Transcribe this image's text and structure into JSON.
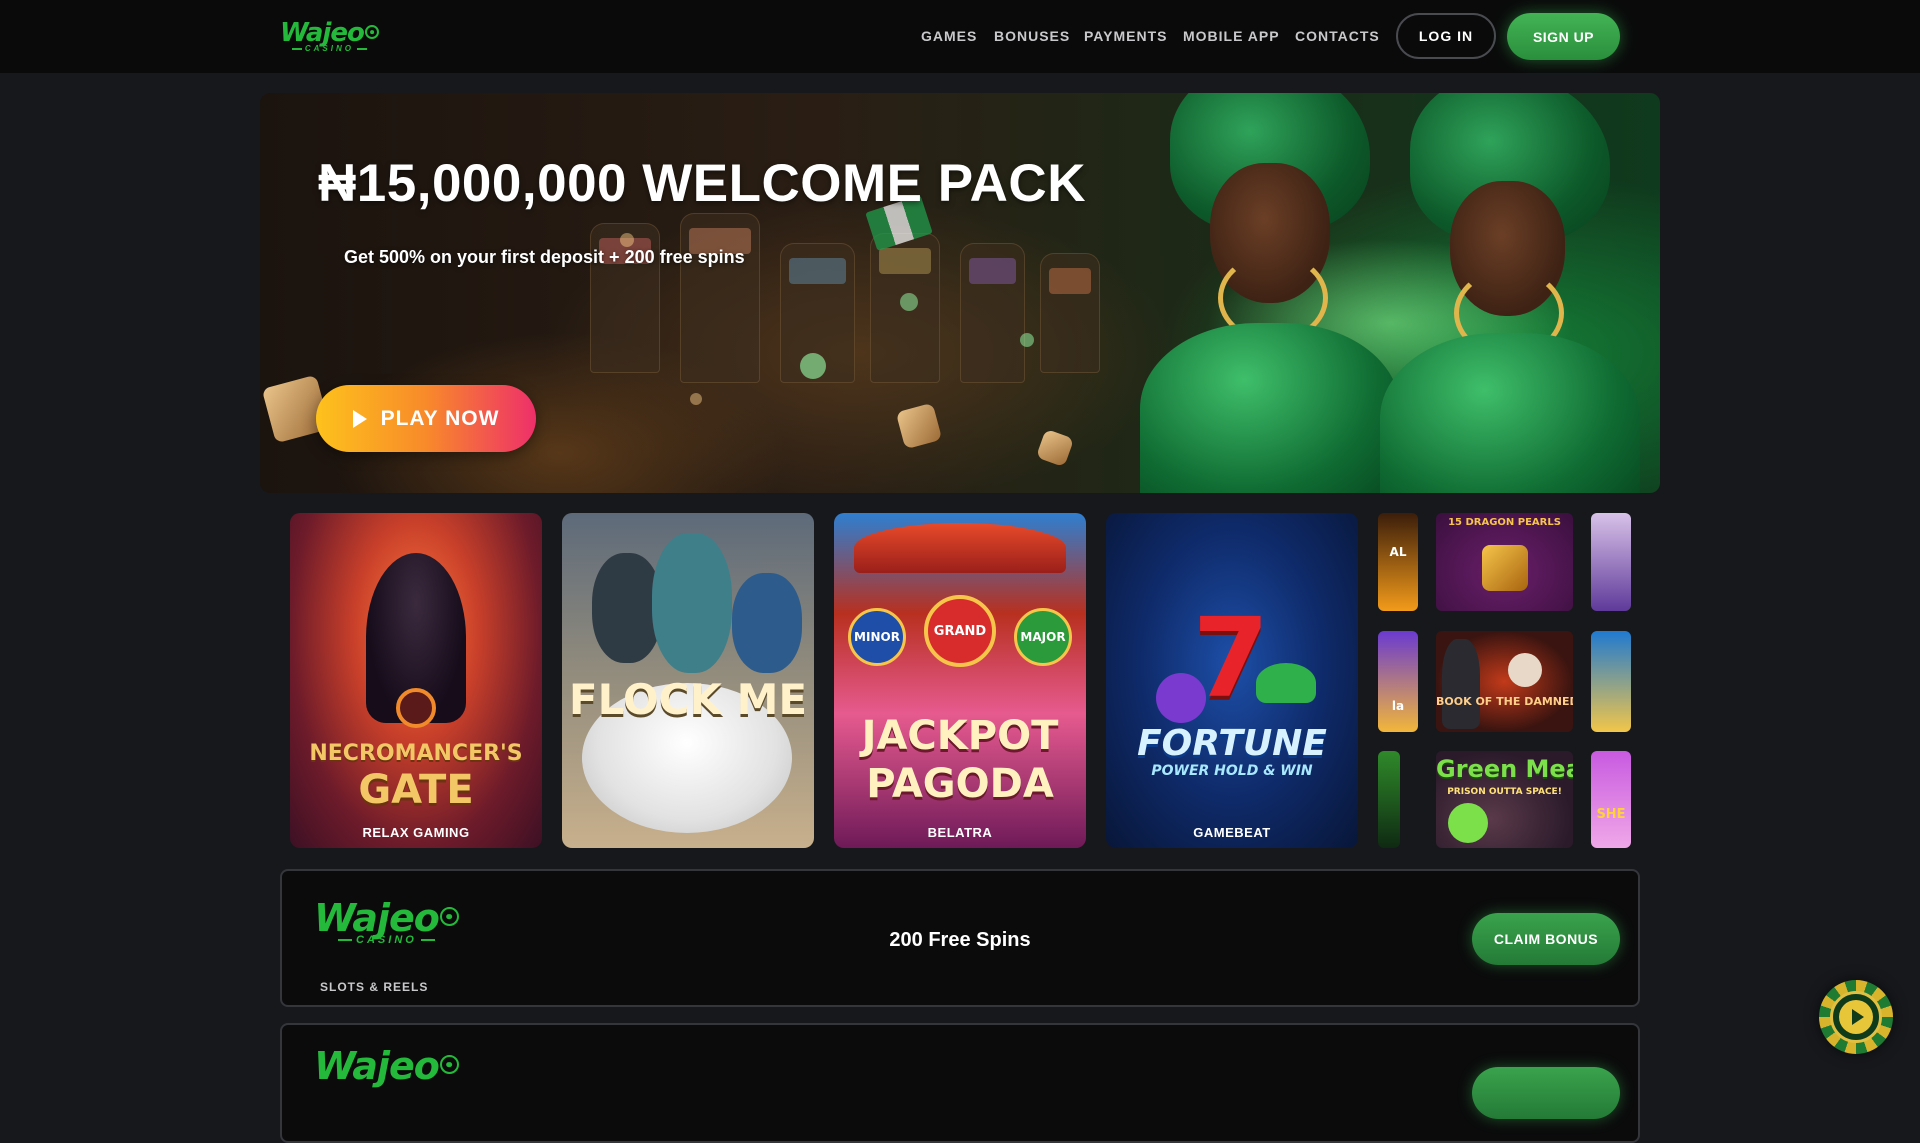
{
  "brand": {
    "name": "Wajeo",
    "sub": "CASINO",
    "accent": "#25b93b"
  },
  "nav": {
    "items": [
      {
        "label": "GAMES"
      },
      {
        "label": "BONUSES"
      },
      {
        "label": "PAYMENTS"
      },
      {
        "label": "MOBILE APP"
      },
      {
        "label": "CONTACTS"
      }
    ],
    "login": "LOG IN",
    "signup": "SIGN UP"
  },
  "hero": {
    "title": "₦15,000,000 WELCOME PACK",
    "subtitle": "Get 500% on your first deposit + 200 free spins",
    "cta": "PLAY NOW"
  },
  "games": [
    {
      "title_line1": "NECROMANCER'S",
      "title_line2": "GATE",
      "provider": "RELAX GAMING"
    },
    {
      "title_line1": "FLOCK ME",
      "title_line2": "",
      "provider": ""
    },
    {
      "title_line1": "JACKPOT",
      "title_line2": "PAGODA",
      "provider": "BELATRA",
      "jackpots": [
        "MINOR",
        "GRAND",
        "MAJOR"
      ]
    },
    {
      "title_line1": "FORTUNE",
      "title_line2": "POWER HOLD & WIN",
      "provider": "GAMEBEAT"
    }
  ],
  "mini_games": {
    "dragon_pearls": "15 DRAGON PEARLS",
    "book_damned": "BOOK OF THE DAMNED",
    "green_meanies": "Green Meanies",
    "green_meanies_sub": "PRISON OUTTA SPACE!",
    "edge_top": "AL",
    "edge_mid": "la",
    "edge_right_bottom": "SHE"
  },
  "bonuses": [
    {
      "category": "SLOTS & REELS",
      "offer": "200 Free Spins",
      "cta": "CLAIM BONUS"
    },
    {
      "category": "",
      "offer": "",
      "cta": ""
    }
  ],
  "floating_icon": "play-chip-icon"
}
